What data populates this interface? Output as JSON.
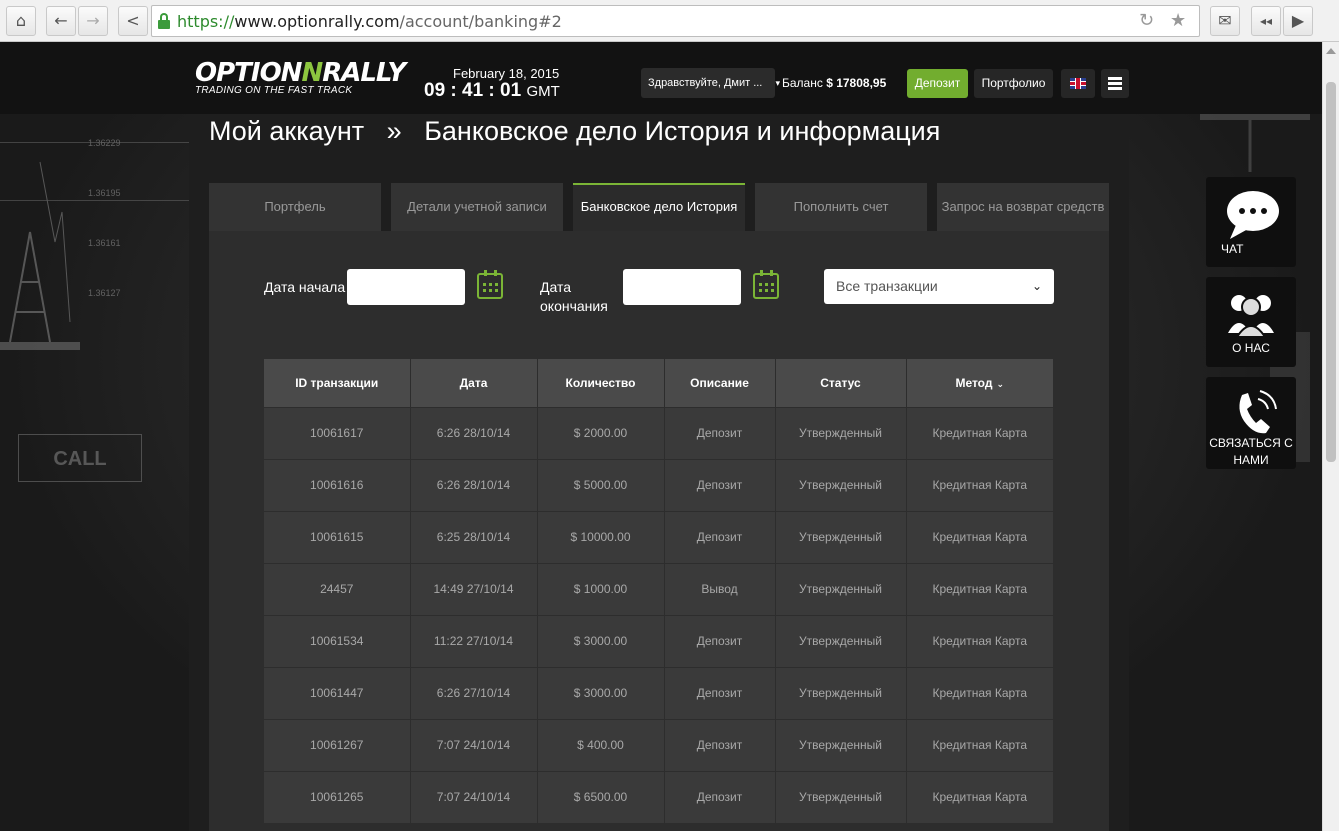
{
  "browser": {
    "url_scheme": "https://",
    "url_host": "www.optionrally.com",
    "url_path": "/account/banking#2",
    "home_icon": "⌂",
    "back_icon": "←",
    "forward_icon": "→",
    "share_icon": "<",
    "reload_icon": "↻",
    "star_icon": "★",
    "mail_icon": "✉",
    "rewind_icon": "◂◂",
    "play_icon": "▶"
  },
  "header": {
    "logo_part1": "OPTION",
    "logo_accent": "N",
    "logo_part2": "RALLY",
    "logo_tagline": "TRADING ON THE FAST TRACK",
    "date": "February 18, 2015",
    "time": "09 : 41 : 01",
    "timezone": "GMT",
    "greeting": "Здравствуйте, Дмит ...",
    "greeting_caret": "▾",
    "balance_label": "Баланс",
    "balance_value": "$ 17808,95",
    "deposit_label": "Депозит",
    "portfolio_label": "Портфолио"
  },
  "background": {
    "ticks": [
      "1.36229",
      "1.36195",
      "1.36161",
      "1.36127"
    ],
    "call_label": "CALL"
  },
  "page": {
    "title_part1": "Мой аккаунт",
    "separator": "»",
    "title_part2": "Банковское дело История и информация"
  },
  "tabs": [
    {
      "label": "Портфель"
    },
    {
      "label": "Детали учетной записи"
    },
    {
      "label": "Банковское дело История"
    },
    {
      "label": "Пополнить счет"
    },
    {
      "label": "Запрос на возврат средств"
    }
  ],
  "filters": {
    "start_label": "Дата начала",
    "start_value": "",
    "end_label_line1": "Дата",
    "end_label_line2": "окончания",
    "end_value": "",
    "type_selected": "Все транзакции",
    "chevron": "⌄"
  },
  "table": {
    "headers": [
      "ID транзакции",
      "Дата",
      "Количество",
      "Описание",
      "Статус",
      "Метод"
    ],
    "sort_caret": "⌄",
    "rows": [
      [
        "10061617",
        "6:26 28/10/14",
        "$ 2000.00",
        "Депозит",
        "Утвержденный",
        "Кредитная Карта"
      ],
      [
        "10061616",
        "6:26 28/10/14",
        "$ 5000.00",
        "Депозит",
        "Утвержденный",
        "Кредитная Карта"
      ],
      [
        "10061615",
        "6:25 28/10/14",
        "$ 10000.00",
        "Депозит",
        "Утвержденный",
        "Кредитная Карта"
      ],
      [
        "24457",
        "14:49 27/10/14",
        "$ 1000.00",
        "Вывод",
        "Утвержденный",
        "Кредитная Карта"
      ],
      [
        "10061534",
        "11:22 27/10/14",
        "$ 3000.00",
        "Депозит",
        "Утвержденный",
        "Кредитная Карта"
      ],
      [
        "10061447",
        "6:26 27/10/14",
        "$ 3000.00",
        "Депозит",
        "Утвержденный",
        "Кредитная Карта"
      ],
      [
        "10061267",
        "7:07 24/10/14",
        "$ 400.00",
        "Депозит",
        "Утвержденный",
        "Кредитная Карта"
      ],
      [
        "10061265",
        "7:07 24/10/14",
        "$ 6500.00",
        "Депозит",
        "Утвержденный",
        "Кредитная Карта"
      ]
    ]
  },
  "widgets": {
    "chat_label": "ЧАТ",
    "about_label": "О НАС",
    "contact_line1": "СВЯЗАТЬСЯ С",
    "contact_line2": "НАМИ"
  },
  "colors": {
    "accent_green": "#7bb536",
    "deposit_green": "#72ad2f"
  }
}
